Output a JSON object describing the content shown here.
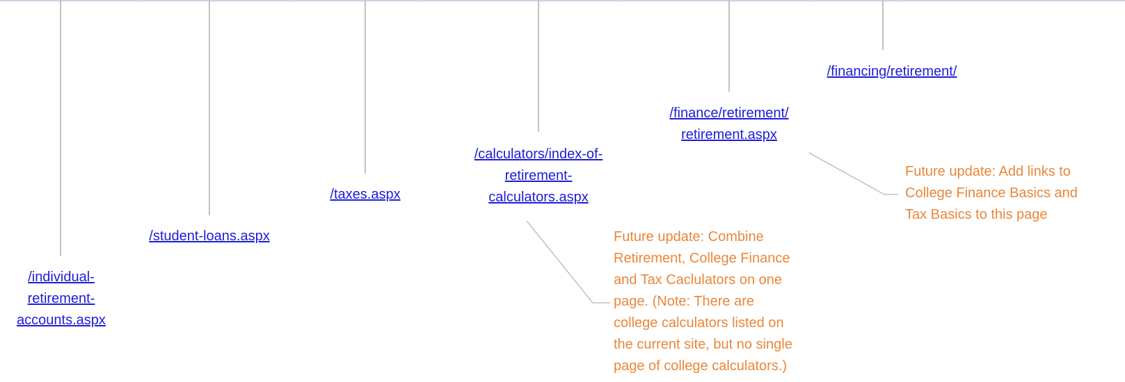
{
  "diagram": {
    "colors": {
      "link": "#1d1dd6",
      "note": "#e8873a",
      "connector": "#c3c3c3",
      "header_rule": "#c9d4e4"
    },
    "nodes": [
      {
        "id": "individual-retirement-accounts",
        "label": "/individual-\nretirement-\naccounts.aspx"
      },
      {
        "id": "student-loans",
        "label": "/student-loans.aspx"
      },
      {
        "id": "taxes",
        "label": "/taxes.aspx"
      },
      {
        "id": "calculators-index",
        "label": "/calculators/index-of-\nretirement-\ncalculators.aspx"
      },
      {
        "id": "finance-retirement",
        "label": "/finance/retirement/\nretirement.aspx"
      },
      {
        "id": "financing-retirement",
        "label": "/financing/retirement/"
      }
    ],
    "notes": [
      {
        "id": "note-calculators",
        "text": "Future update: Combine\nRetirement, College Finance\nand Tax Caclulators on one\npage. (Note: There are\ncollege calculators listed on\nthe current site, but no single\npage of college calculators.)"
      },
      {
        "id": "note-finance",
        "text": "Future update: Add links to\nCollege Finance Basics and\nTax Basics to this page"
      }
    ]
  }
}
